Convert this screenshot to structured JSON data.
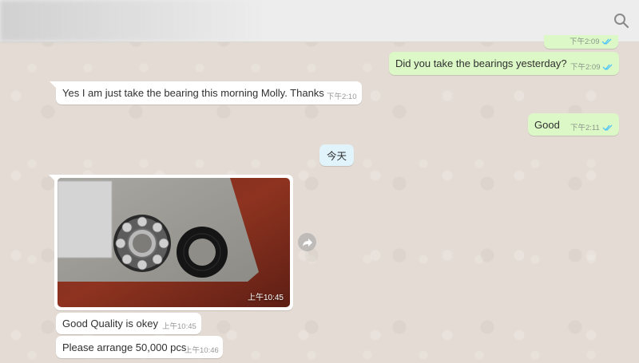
{
  "header": {
    "search_icon": "search-icon"
  },
  "messages": [
    {
      "text": "Did you take the bearings yesterday?",
      "time": "下午2:09",
      "direction": "out",
      "status": "read"
    },
    {
      "text": "Yes I am just take the bearing this morning Molly. Thanks",
      "time": "下午2:10",
      "direction": "in"
    },
    {
      "text": "Good",
      "time": "下午2:11",
      "direction": "out",
      "status": "read"
    },
    {
      "text": "Good Quality is okey",
      "time": "上午10:45",
      "direction": "in"
    },
    {
      "text": "Please arrange 50,000 pcs",
      "time": "上午10:46",
      "direction": "in"
    }
  ],
  "prev_message_time": "下午2:09",
  "date_divider": "今天",
  "photo_message": {
    "time": "上午10:45",
    "subject": "bearing and seal photo"
  },
  "colors": {
    "outgoing": "#dcf8c6",
    "incoming": "#ffffff",
    "read_ticks": "#4fc3f7",
    "date_chip": "#e1f3fb"
  }
}
